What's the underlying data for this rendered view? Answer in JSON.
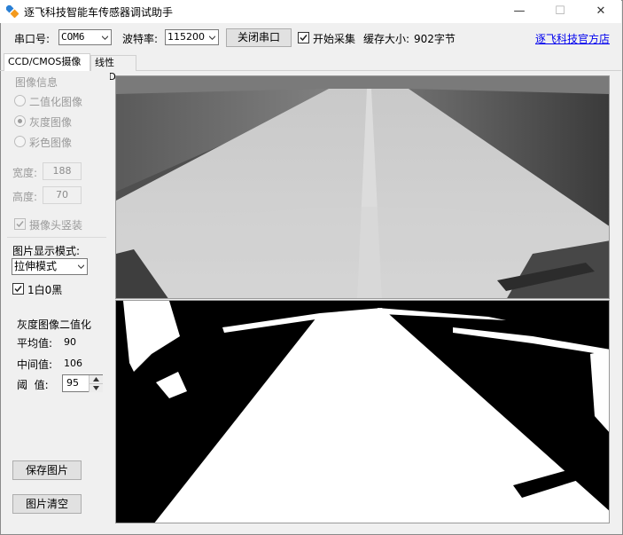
{
  "window": {
    "title": "逐飞科技智能车传感器调试助手",
    "minimize_glyph": "—",
    "maximize_glyph": "☐",
    "close_glyph": "✕"
  },
  "toolbar": {
    "port_label": "串口号:",
    "port_value": "COM6",
    "baud_label": "波特率:",
    "baud_value": "115200",
    "close_port_button": "关闭串口",
    "start_capture_label": "开始采集",
    "start_capture_checked": true,
    "buffer_label": "缓存大小:",
    "buffer_value": "902字节",
    "official_link": "逐飞科技官方店"
  },
  "tabs": [
    {
      "label": "CCD/CMOS摄像头",
      "active": true
    },
    {
      "label": "线性CCD",
      "active": false
    }
  ],
  "image_info": {
    "group_title": "图像信息",
    "options": [
      {
        "label": "二值化图像",
        "checked": false
      },
      {
        "label": "灰度图像",
        "checked": true
      },
      {
        "label": "彩色图像",
        "checked": false
      }
    ],
    "width_label": "宽度:",
    "width_value": "188",
    "height_label": "高度:",
    "height_value": "70",
    "camera_vertical_label": "摄像头竖装",
    "camera_vertical_checked": true
  },
  "display": {
    "mode_label": "图片显示模式:",
    "mode_value": "拉伸模式",
    "white_black_label": "1白0黑",
    "white_black_checked": true
  },
  "binarize": {
    "title": "灰度图像二值化",
    "mean_label": "平均值:",
    "mean_value": "90",
    "median_label": "中间值:",
    "median_value": "106",
    "threshold_label": "阈  值:",
    "threshold_value": "95"
  },
  "buttons": {
    "save_image": "保存图片",
    "clear_image": "图片清空"
  },
  "colors": {
    "link": "#0000ee",
    "icon_blue": "#2a7fd4",
    "icon_orange": "#f39a1e"
  }
}
